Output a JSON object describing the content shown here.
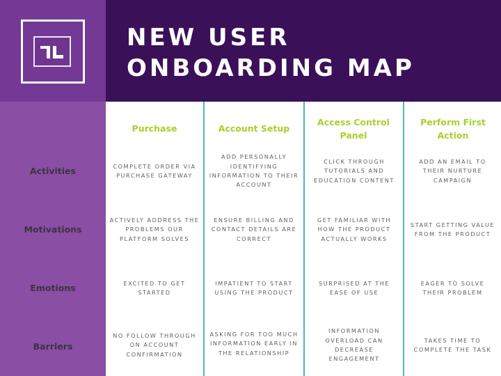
{
  "title": {
    "line1": "NEW USER",
    "line2": "ONBOARDING MAP"
  },
  "logo": {
    "text": "TL",
    "icon": "tl-logo-icon"
  },
  "colors": {
    "logo_bg": "#743895",
    "header_bg": "#3a1058",
    "sidebar_bg": "#8a4ea4",
    "accent_green": "#a6d12c",
    "divider_teal": "#4fb8b0",
    "row_label": "#3b3441",
    "cell_text": "#5f5f63"
  },
  "columns": [
    {
      "label": "Purchase"
    },
    {
      "label": "Account Setup"
    },
    {
      "label": "Access Control Panel"
    },
    {
      "label": "Perform First Action"
    }
  ],
  "rows": [
    {
      "label": "Activities",
      "cells": [
        "Complete order via purchase gateway",
        "Add personally identifying information to their account",
        "Click through tutorials and education content",
        "Add an email to their nurture campaign"
      ]
    },
    {
      "label": "Motivations",
      "cells": [
        "Actively address the problems our platform solves",
        "Ensure billing and contact details are correct",
        "Get familiar with how the product actually works",
        "Start getting value from the product"
      ]
    },
    {
      "label": "Emotions",
      "cells": [
        "Excited to get started",
        "Impatient to start using the product",
        "Surprised at the ease of use",
        "Eager to solve their problem"
      ]
    },
    {
      "label": "Barriers",
      "cells": [
        "No follow through on account confirmation",
        "Asking for too much information early in the relationship",
        "Information overload can decrease engagement",
        "Takes time to complete the task"
      ]
    }
  ]
}
